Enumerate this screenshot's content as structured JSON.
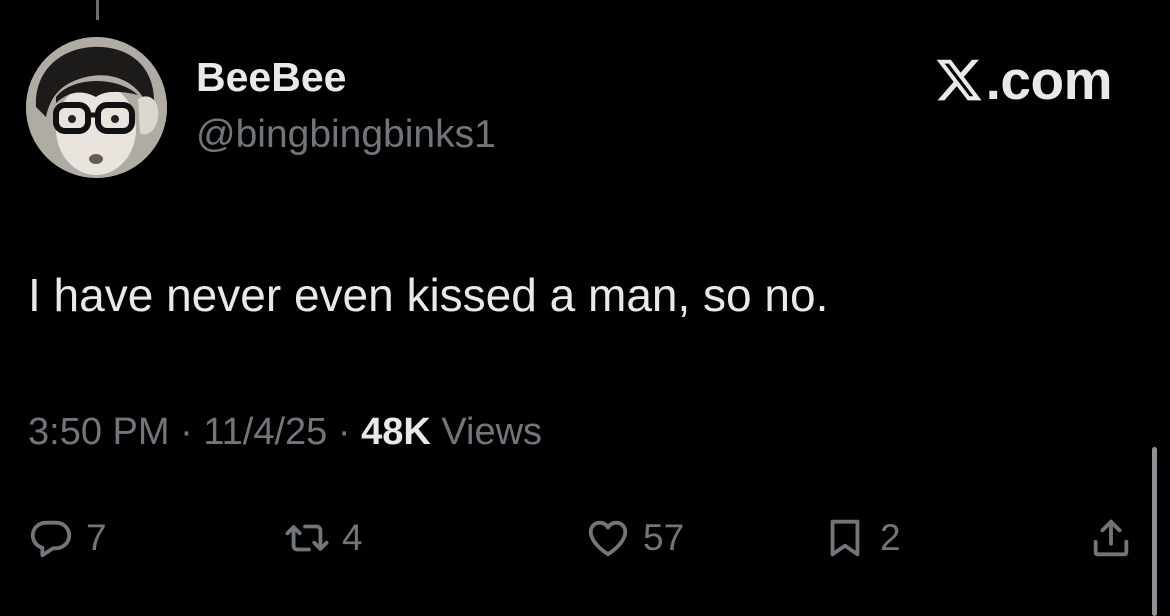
{
  "user": {
    "display_name": "BeeBee",
    "handle": "@bingbingbinks1"
  },
  "brand": {
    "text": ".com",
    "logo": "x-logo-icon"
  },
  "tweet": {
    "text": "I have never even kissed a man, so no.",
    "time": "3:50 PM",
    "date": "11/4/25",
    "separator": " · ",
    "views_count": "48K",
    "views_label": "Views"
  },
  "actions": {
    "reply": {
      "icon": "reply-bubble-icon",
      "count": "7"
    },
    "retweet": {
      "icon": "retweet-icon",
      "count": "4"
    },
    "like": {
      "icon": "heart-icon",
      "count": "57"
    },
    "bookmark": {
      "icon": "bookmark-icon",
      "count": "2"
    },
    "share": {
      "icon": "share-icon"
    }
  },
  "colors": {
    "background": "#000000",
    "primary_text": "#e7e9ea",
    "secondary_text": "#71767b"
  }
}
